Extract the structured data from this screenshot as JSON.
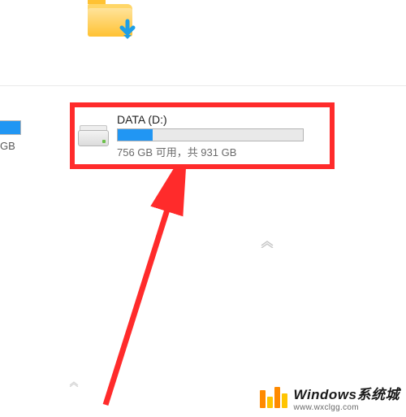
{
  "partial": {
    "text_suffix": "GB"
  },
  "drive": {
    "name": "DATA (D:)",
    "usage_text": "756 GB 可用，共 931 GB",
    "fill_percent": 19
  },
  "watermark": {
    "title": "Windows系统城",
    "url": "www.wxclgg.com"
  }
}
